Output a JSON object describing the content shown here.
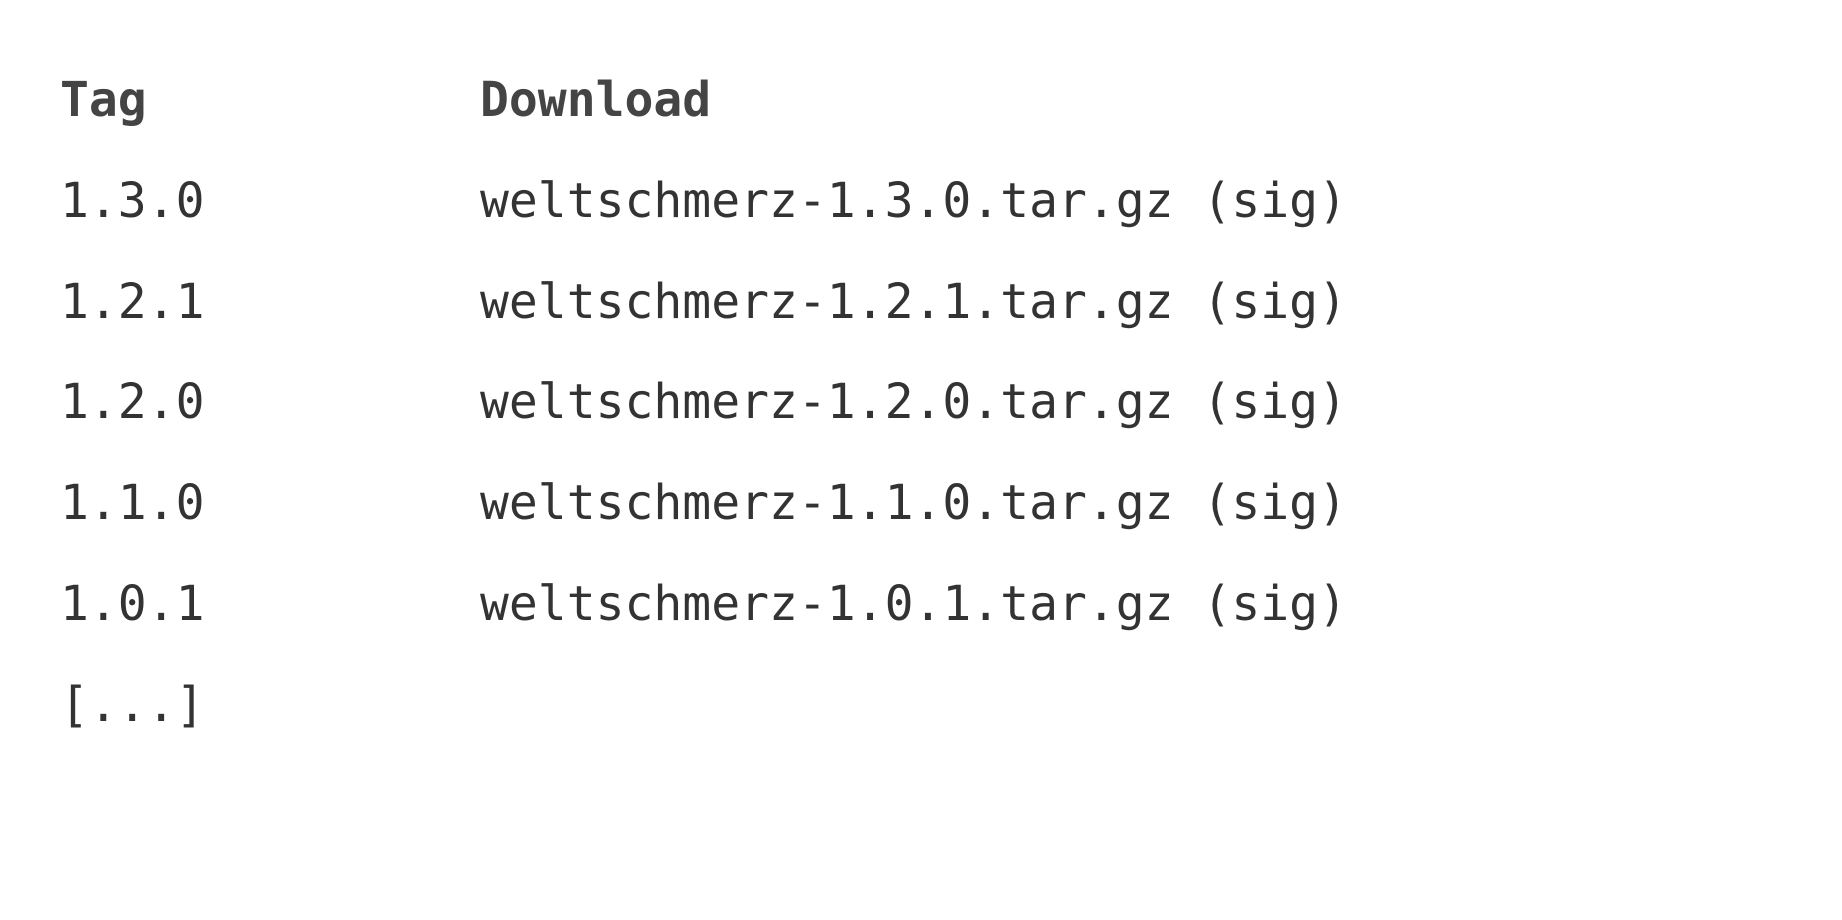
{
  "headers": {
    "tag": "Tag",
    "download": "Download"
  },
  "rows": [
    {
      "tag": "1.3.0",
      "file": "weltschmerz-1.3.0.tar.gz",
      "sig_open": " (",
      "sig": "sig",
      "sig_close": ")"
    },
    {
      "tag": "1.2.1",
      "file": "weltschmerz-1.2.1.tar.gz",
      "sig_open": " (",
      "sig": "sig",
      "sig_close": ")"
    },
    {
      "tag": "1.2.0",
      "file": "weltschmerz-1.2.0.tar.gz",
      "sig_open": " (",
      "sig": "sig",
      "sig_close": ")"
    },
    {
      "tag": "1.1.0",
      "file": "weltschmerz-1.1.0.tar.gz",
      "sig_open": " (",
      "sig": "sig",
      "sig_close": ")"
    },
    {
      "tag": "1.0.1",
      "file": "weltschmerz-1.0.1.tar.gz",
      "sig_open": " (",
      "sig": "sig",
      "sig_close": ")"
    }
  ],
  "ellipsis": "[...]"
}
